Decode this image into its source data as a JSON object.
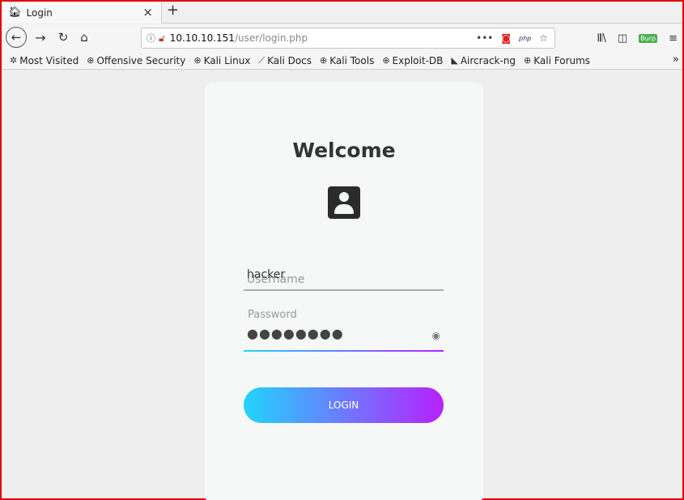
{
  "browser": {
    "tab_title": "Login",
    "tab_close": "×",
    "new_tab": "+",
    "url_host": "10.10.10.151",
    "url_path": "/user/login.php",
    "url_menu": "•••",
    "php_badge": "php",
    "burp_badge": "Burp"
  },
  "bookmarks": [
    {
      "label": "Most Visited",
      "icon": "gear-icon"
    },
    {
      "label": "Offensive Security",
      "icon": "globe-icon"
    },
    {
      "label": "Kali Linux",
      "icon": "globe-icon"
    },
    {
      "label": "Kali Docs",
      "icon": "kali-icon"
    },
    {
      "label": "Kali Tools",
      "icon": "globe-icon"
    },
    {
      "label": "Exploit-DB",
      "icon": "globe-icon"
    },
    {
      "label": "Aircrack-ng",
      "icon": "aircrack-icon"
    },
    {
      "label": "Kali Forums",
      "icon": "globe-icon"
    }
  ],
  "login": {
    "title": "Welcome",
    "username_value": "hacker",
    "username_placeholder": "Username",
    "password_label": "Password",
    "password_mask": "●●●●●●●●",
    "button_label": "LOGIN"
  },
  "colors": {
    "gradient_start": "#21d4fd",
    "gradient_end": "#b721ff",
    "frame_border": "#e00000"
  }
}
